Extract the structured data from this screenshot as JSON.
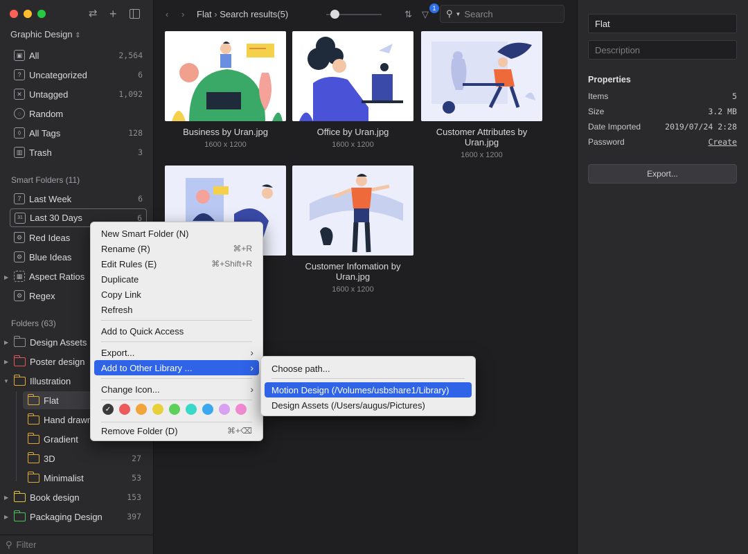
{
  "library": {
    "name": "Graphic Design"
  },
  "nav": [
    {
      "label": "All",
      "count": "2,564",
      "glyph": "▣"
    },
    {
      "label": "Uncategorized",
      "count": "6",
      "glyph": "?"
    },
    {
      "label": "Untagged",
      "count": "1,092",
      "glyph": "✕"
    },
    {
      "label": "Random",
      "count": "",
      "glyph": "◌"
    },
    {
      "label": "All Tags",
      "count": "128",
      "glyph": "◊"
    },
    {
      "label": "Trash",
      "count": "3",
      "glyph": "▥"
    }
  ],
  "smart_folders": {
    "title": "Smart Folders (11)",
    "items": [
      {
        "label": "Last Week",
        "count": "6",
        "glyph": "7"
      },
      {
        "label": "Last 30 Days",
        "count": "6",
        "glyph": "31"
      },
      {
        "label": "Red Ideas",
        "count": ""
      },
      {
        "label": "Blue Ideas",
        "count": ""
      },
      {
        "label": "Aspect Ratios",
        "count": ""
      },
      {
        "label": "Regex",
        "count": ""
      }
    ]
  },
  "folders": {
    "title": "Folders (63)",
    "items": [
      {
        "label": "Design Assets",
        "count": "",
        "color": "#8d8d92"
      },
      {
        "label": "Poster design",
        "count": "",
        "color": "#e05858"
      },
      {
        "label": "Illustration",
        "count": "",
        "color": "#e0a93a"
      },
      {
        "label": "Flat",
        "count": "",
        "color": "#e0a93a"
      },
      {
        "label": "Hand drawn",
        "count": "",
        "color": "#e0a93a"
      },
      {
        "label": "Gradient",
        "count": "",
        "color": "#e0a93a"
      },
      {
        "label": "3D",
        "count": "27",
        "color": "#e0a93a"
      },
      {
        "label": "Minimalist",
        "count": "53",
        "color": "#e0a93a"
      },
      {
        "label": "Book design",
        "count": "153",
        "color": "#e0c53a"
      },
      {
        "label": "Packaging Design",
        "count": "397",
        "color": "#4cc05a"
      }
    ]
  },
  "filter_placeholder": "Filter",
  "toolbar": {
    "crumb_folder": "Flat",
    "crumb_results": "Search results(5)",
    "search_placeholder": "Search",
    "filter_badge": "1",
    "zoom_level": 0.15
  },
  "items": [
    {
      "name": "Business by Uran.jpg",
      "dims": "1600 x 1200"
    },
    {
      "name": "Office by Uran.jpg",
      "dims": "1600 x 1200"
    },
    {
      "name": "Customer Attributes by Uran.jpg",
      "dims": "1600 x 1200"
    },
    {
      "name": "",
      "dims": ""
    },
    {
      "name": "Customer Infomation by Uran.jpg",
      "dims": "1600 x 1200"
    }
  ],
  "inspector": {
    "name": "Flat",
    "description_placeholder": "Description",
    "properties_title": "Properties",
    "props": [
      {
        "label": "Items",
        "value": "5"
      },
      {
        "label": "Size",
        "value": "3.2 MB"
      },
      {
        "label": "Date Imported",
        "value": "2019/07/24 2:28"
      },
      {
        "label": "Password",
        "value": "Create"
      }
    ],
    "export_label": "Export..."
  },
  "context_menu": {
    "items": [
      {
        "label": "New Smart Folder (N)",
        "shortcut": ""
      },
      {
        "label": "Rename (R)",
        "shortcut": "⌘+R"
      },
      {
        "label": "Edit Rules (E)",
        "shortcut": "⌘+Shift+R"
      },
      {
        "label": "Duplicate",
        "shortcut": ""
      },
      {
        "label": "Copy Link",
        "shortcut": ""
      },
      {
        "label": "Refresh",
        "shortcut": ""
      },
      {
        "label": "Add to Quick Access",
        "shortcut": ""
      },
      {
        "label": "Export...",
        "shortcut": ""
      },
      {
        "label": "Add to Other Library ...",
        "shortcut": ""
      },
      {
        "label": "Change Icon...",
        "shortcut": ""
      },
      {
        "label": "Remove Folder (D)",
        "shortcut": "⌘+⌫"
      }
    ],
    "colors": [
      "#3a3a3a",
      "#ee5a5a",
      "#f2a33a",
      "#e8d03a",
      "#5cd05a",
      "#3ad8c8",
      "#3aa8f0",
      "#d8a0f0",
      "#f08ad0"
    ]
  },
  "submenu": {
    "choose": "Choose path...",
    "libraries": [
      "Motion Design (/Volumes/usbshare1/Library)",
      "Design Assets (/Users/augus/Pictures)"
    ]
  }
}
